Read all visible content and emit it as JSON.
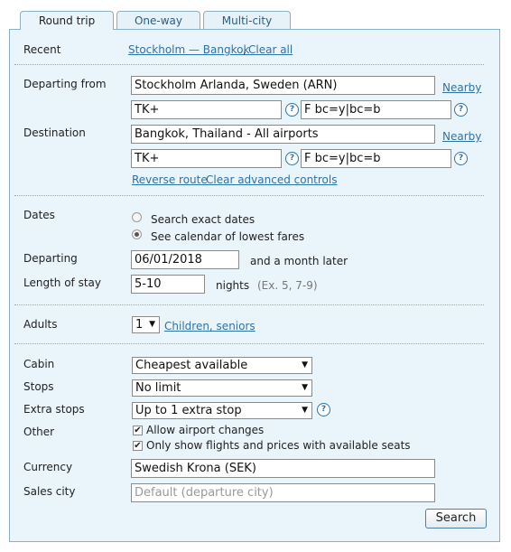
{
  "tabs": [
    "Round trip",
    "One-way",
    "Multi-city"
  ],
  "recent": {
    "label": "Recent",
    "route": "Stockholm — Bangkok",
    "comma": ",",
    "clear": "Clear all"
  },
  "from": {
    "label": "Departing from",
    "value": "Stockholm Arlanda, Sweden (ARN)",
    "nearby": "Nearby",
    "routing": "TK+",
    "extension": "F bc=y|bc=b"
  },
  "dest": {
    "label": "Destination",
    "value": "Bangkok, Thailand - All airports",
    "nearby": "Nearby",
    "routing": "TK+",
    "extension": "F bc=y|bc=b"
  },
  "route_links": {
    "reverse": "Reverse route",
    "clear_adv": "Clear advanced controls"
  },
  "dates": {
    "label": "Dates",
    "exact": "Search exact dates",
    "calendar": "See calendar of lowest fares",
    "selected": "calendar"
  },
  "departing": {
    "label": "Departing",
    "value": "06/01/2018",
    "suffix": "and a month later"
  },
  "stay": {
    "label": "Length of stay",
    "value": "5-10",
    "unit": "nights",
    "hint": "(Ex. 5, 7-9)"
  },
  "adults": {
    "label": "Adults",
    "value": "1",
    "children_link": "Children, seniors"
  },
  "cabin": {
    "label": "Cabin",
    "value": "Cheapest available"
  },
  "stops": {
    "label": "Stops",
    "value": "No limit"
  },
  "extra_stops": {
    "label": "Extra stops",
    "value": "Up to 1 extra stop"
  },
  "other": {
    "label": "Other",
    "allow_changes": "Allow airport changes",
    "only_available": "Only show flights and prices with available seats",
    "allow_changes_checked": true,
    "only_available_checked": true
  },
  "currency": {
    "label": "Currency",
    "value": "Swedish Krona (SEK)"
  },
  "sales_city": {
    "label": "Sales city",
    "placeholder": "Default (departure city)"
  },
  "search_button": "Search",
  "help_glyph": "?",
  "check_glyph": "✔",
  "arrow_glyph": "▼"
}
